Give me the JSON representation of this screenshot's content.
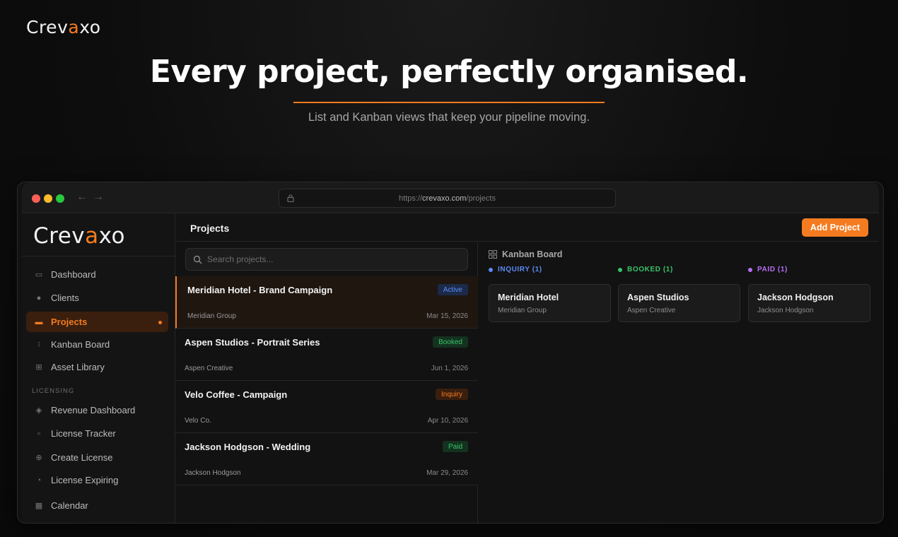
{
  "brand": {
    "name_start": "Crev",
    "name_accent": "a",
    "name_end": "xo",
    "accent_color": "#f47b20"
  },
  "hero": {
    "title": "Every project, perfectly organised.",
    "subtitle": "List and Kanban views that keep your pipeline moving."
  },
  "browser": {
    "url_scheme": "https://",
    "url_host": "crevaxo.com",
    "url_path": "/projects",
    "back_arrow": "←",
    "forward_arrow": "→"
  },
  "sidebar": {
    "items": [
      {
        "label": "Dashboard",
        "icon": "dashboard-icon",
        "glyph": "▭"
      },
      {
        "label": "Clients",
        "icon": "clients-icon",
        "glyph": "●"
      },
      {
        "label": "Projects",
        "icon": "projects-icon",
        "glyph": "▬",
        "active": true
      },
      {
        "label": "Kanban Board",
        "icon": "kanban-icon",
        "glyph": "⁝"
      },
      {
        "label": "Asset Library",
        "icon": "asset-library-icon",
        "glyph": "⊞"
      }
    ],
    "section_label": "LICENSING",
    "licensing_items": [
      {
        "label": "Revenue Dashboard",
        "icon": "revenue-icon",
        "glyph": "◈"
      },
      {
        "label": "License Tracker",
        "icon": "license-tracker-icon",
        "glyph": "▫"
      },
      {
        "label": "Create License",
        "icon": "create-license-icon",
        "glyph": "⊕"
      },
      {
        "label": "License Expiring",
        "icon": "license-expiring-icon",
        "glyph": "◔"
      }
    ],
    "bottom_items": [
      {
        "label": "Calendar",
        "icon": "calendar-icon",
        "glyph": "▦"
      }
    ]
  },
  "header": {
    "title": "Projects",
    "add_button": "Add Project"
  },
  "search": {
    "placeholder": "Search projects..."
  },
  "projects": [
    {
      "title": "Meridian Hotel - Brand Campaign",
      "client": "Meridian Group",
      "date": "Mar 15, 2026",
      "status": "Active",
      "status_color": "#5b8cf5",
      "status_bg": "#1c2a4a",
      "selected": true
    },
    {
      "title": "Aspen Studios - Portrait Series",
      "client": "Aspen Creative",
      "date": "Jun 1, 2026",
      "status": "Booked",
      "status_color": "#39c46a",
      "status_bg": "#14321f"
    },
    {
      "title": "Velo Coffee - Campaign",
      "client": "Velo Co.",
      "date": "Apr 10, 2026",
      "status": "Inquiry",
      "status_color": "#f47b20",
      "status_bg": "#3a1f0e"
    },
    {
      "title": "Jackson Hodgson - Wedding",
      "client": "Jackson Hodgson",
      "date": "Mar 29, 2026",
      "status": "Paid",
      "status_color": "#39c46a",
      "status_bg": "#14321f"
    }
  ],
  "kanban": {
    "title": "Kanban Board",
    "columns": [
      {
        "label": "INQUIRY (1)",
        "color": "#5b8cf5",
        "card": {
          "title": "Meridian Hotel",
          "sub": "Meridian Group"
        }
      },
      {
        "label": "BOOKED (1)",
        "color": "#39c46a",
        "card": {
          "title": "Aspen Studios",
          "sub": "Aspen Creative"
        }
      },
      {
        "label": "PAID (1)",
        "color": "#b46ef5",
        "card": {
          "title": "Jackson Hodgson",
          "sub": "Jackson Hodgson"
        }
      }
    ]
  }
}
